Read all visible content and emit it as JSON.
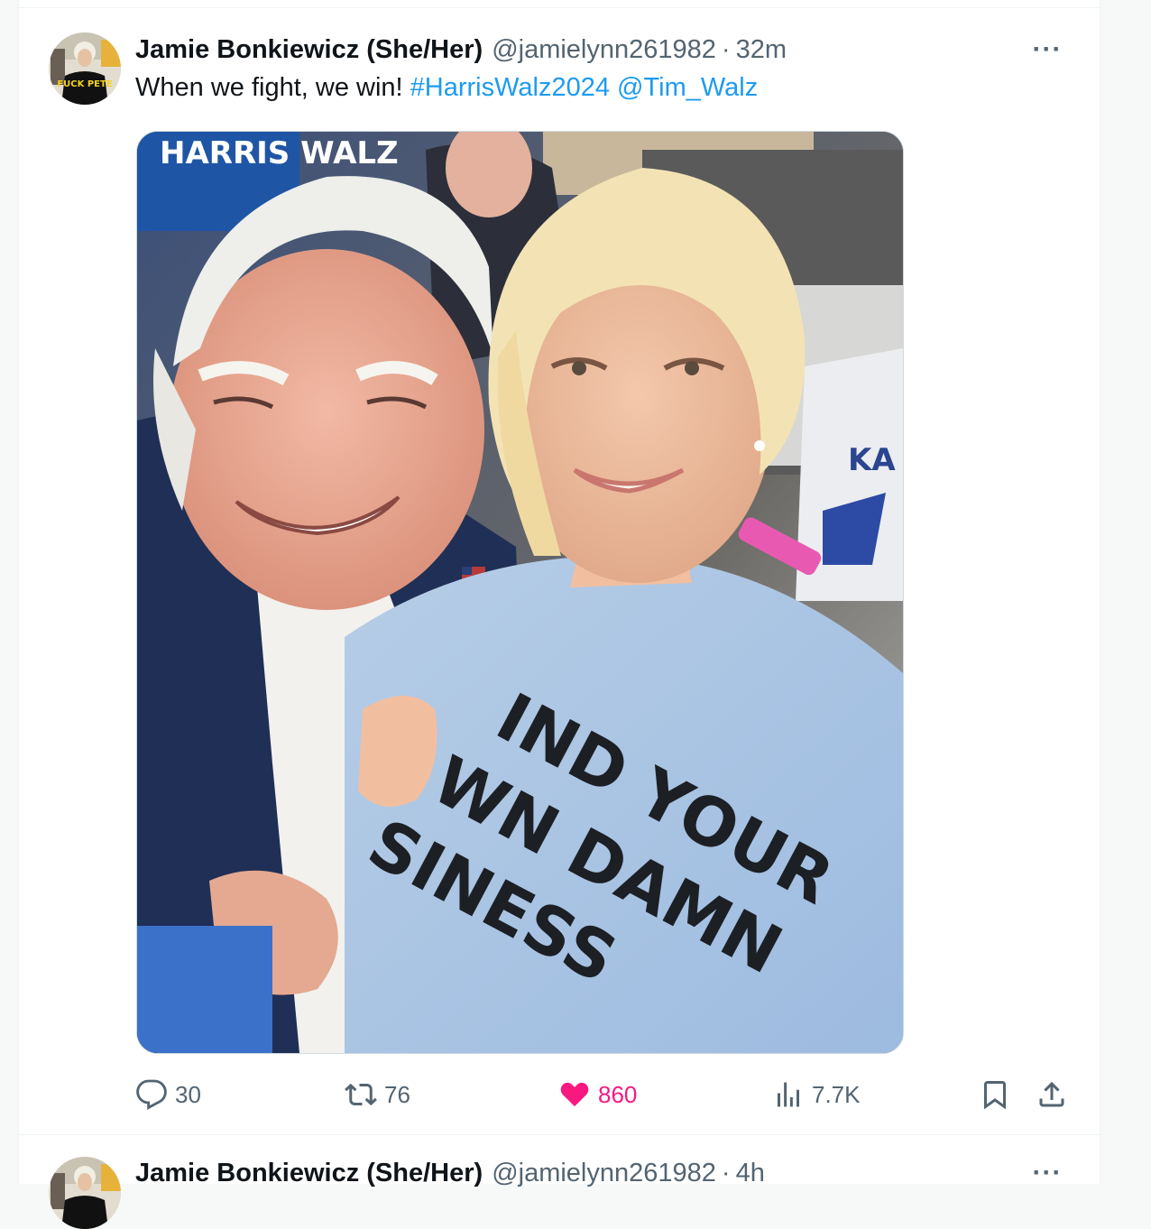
{
  "tweets": [
    {
      "author": {
        "display_name": "Jamie Bonkiewicz (She/Her)",
        "handle": "@jamielynn261982",
        "avatar_text": "FUCK PETE"
      },
      "separator": "·",
      "time": "32m",
      "text": {
        "plain": "When we fight, we win!",
        "hashtag": "#HarrisWalz2024",
        "mention": "@Tim_Walz"
      },
      "media": {
        "sign_text": "HARRIS WALZ",
        "shirt_text": [
          "IND YOUR",
          "WN DAMN",
          "SINESS"
        ],
        "background_shirt_text": "KA"
      },
      "stats": {
        "replies": "30",
        "reposts": "76",
        "likes": "860",
        "views": "7.7K"
      },
      "more_label": "···"
    },
    {
      "author": {
        "display_name": "Jamie Bonkiewicz (She/Her)",
        "handle": "@jamielynn261982"
      },
      "separator": "·",
      "time": "4h",
      "more_label": "···"
    }
  ],
  "colors": {
    "link": "#1d9bf0",
    "like_active": "#f91880",
    "muted": "#536471",
    "text": "#0f1419",
    "divider": "#eff3f4"
  },
  "icons": {
    "reply": "speech-bubble-icon",
    "repost": "repost-arrows-icon",
    "like": "heart-icon",
    "views": "bar-chart-icon",
    "bookmark": "bookmark-icon",
    "share": "share-upload-icon"
  }
}
